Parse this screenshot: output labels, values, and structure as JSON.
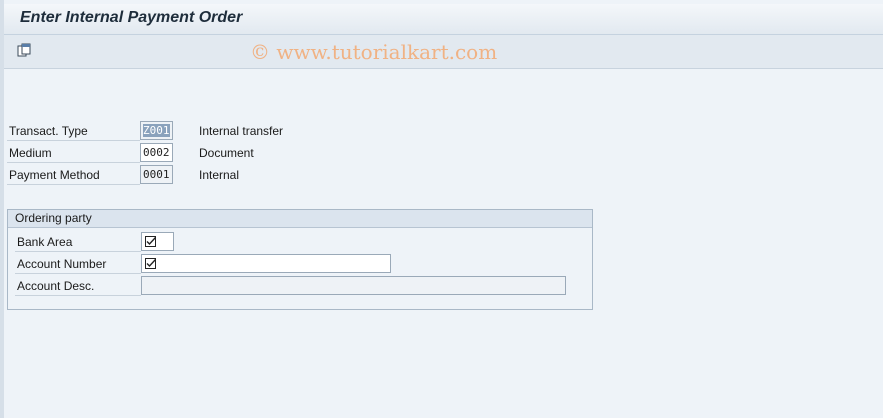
{
  "title": "Enter Internal Payment Order",
  "watermark": "© www.tutorialkart.com",
  "toolbar": {
    "icon": "copy-icon"
  },
  "fields": [
    {
      "label": "Transact. Type",
      "value": "Z001",
      "desc": "Internal transfer"
    },
    {
      "label": "Medium",
      "value": "0002",
      "desc": "Document"
    },
    {
      "label": "Payment Method",
      "value": "0001",
      "desc": "Internal"
    }
  ],
  "ordering_party": {
    "title": "Ordering party",
    "bank_area_label": "Bank Area",
    "bank_area_value": "",
    "account_number_label": "Account Number",
    "account_number_value": "",
    "account_desc_label": "Account Desc.",
    "account_desc_value": "",
    "required_icon": "checkbox-required-icon"
  }
}
